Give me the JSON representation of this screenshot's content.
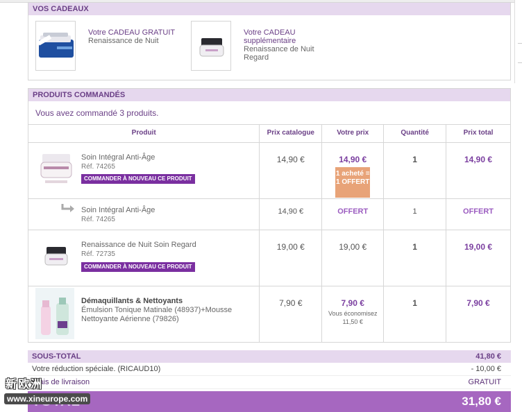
{
  "gifts_panel": {
    "header": "VOS CADEAUX",
    "items": [
      {
        "title": "Votre CADEAU GRATUIT",
        "subtitle": "Renaissance de Nuit"
      },
      {
        "title": "Votre CADEAU supplémentaire",
        "subtitle": "Renaissance de Nuit Regard"
      }
    ]
  },
  "products_panel": {
    "header": "PRODUITS COMMANDÉS",
    "summary": "Vous avez commandé 3 produits.",
    "columns": [
      "Produit",
      "Prix catalogue",
      "Votre prix",
      "Quantité",
      "Prix total"
    ],
    "rows": [
      {
        "name": "Soin Intégral Anti-Âge",
        "ref": "Réf. 74265",
        "reorder_label": "COMMANDER À NOUVEAU CE PRODUIT",
        "catalog_price": "14,90 €",
        "your_price": "14,90 €",
        "promo": "1 acheté = 1 OFFERT",
        "quantity": "1",
        "total": "14,90 €"
      },
      {
        "name": "Soin Intégral Anti-Âge",
        "ref": "Réf. 74265",
        "catalog_price": "14,90 €",
        "your_price": "OFFERT",
        "quantity": "1",
        "total": "OFFERT"
      },
      {
        "name": "Renaissance de Nuit Soin Regard",
        "ref": "Réf. 72735",
        "reorder_label": "COMMANDER À NOUVEAU CE PRODUIT",
        "catalog_price": "19,00 €",
        "your_price": "19,00 €",
        "quantity": "1",
        "total": "19,00 €"
      },
      {
        "name": "Démaquillants & Nettoyants",
        "description": "Émulsion Tonique Matinale (48937)+Mousse Nettoyante Aérienne (79826)",
        "catalog_price": "7,90 €",
        "your_price": "7,90 €",
        "savings_label": "Vous économisez",
        "savings_value": "11,50 €",
        "quantity": "1",
        "total": "7,90 €"
      }
    ]
  },
  "totals": {
    "subtotal_label": "SOUS-TOTAL",
    "subtotal_value": "41,80 €",
    "discount_label": "Votre réduction spéciale. (RICAUD10)",
    "discount_value": "- 10,00 €",
    "shipping_label": "Frais de livraison",
    "shipping_value": "GRATUIT",
    "total_label": "TOTAL",
    "total_value": "31,80 €"
  },
  "watermark": {
    "logo_text": "新欧洲",
    "url": "www.xineurope.com"
  },
  "colors": {
    "accent": "#7b3fa0",
    "header_bg": "#e6d8ee",
    "total_bg": "#a667c0",
    "promo_bg": "#e8a378"
  }
}
